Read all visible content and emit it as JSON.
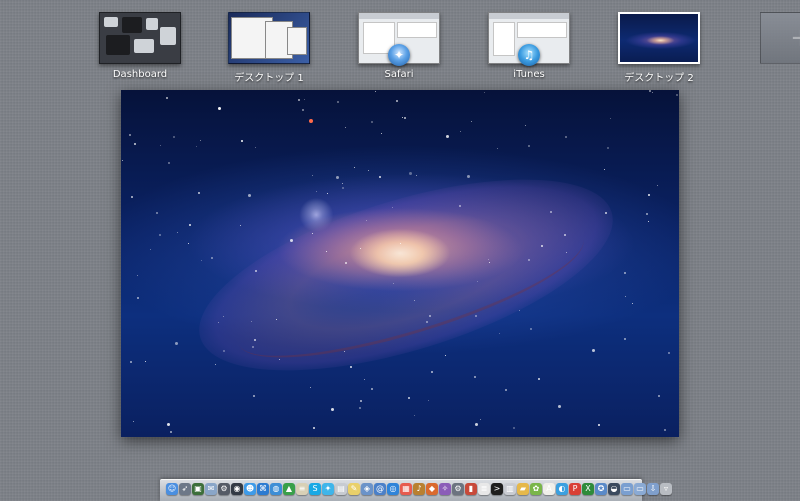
{
  "spaces": [
    {
      "label": "Dashboard",
      "kind": "dashboard",
      "active": false
    },
    {
      "label": "デスクトップ 1",
      "kind": "desktop",
      "active": false
    },
    {
      "label": "Safari",
      "kind": "app",
      "icon": "safari-icon",
      "active": false
    },
    {
      "label": "iTunes",
      "kind": "app",
      "icon": "itunes-icon",
      "active": false
    },
    {
      "label": "デスクトップ 2",
      "kind": "desktop",
      "active": true
    }
  ],
  "add_space": {
    "icon": "plus-icon"
  },
  "desktop_preview": {
    "wallpaper": "andromeda-galaxy"
  },
  "dock": {
    "icons": [
      {
        "name": "finder-icon",
        "color": "#4a8fe0",
        "glyph": "☺"
      },
      {
        "name": "rocket-icon",
        "color": "#6d7888",
        "glyph": "➶"
      },
      {
        "name": "photo-icon",
        "color": "#3d6f3a",
        "glyph": "▣"
      },
      {
        "name": "mail-icon",
        "color": "#8aa6c8",
        "glyph": "✉"
      },
      {
        "name": "system-icon",
        "color": "#555b66",
        "glyph": "⚙"
      },
      {
        "name": "camera-icon",
        "color": "#333a44",
        "glyph": "◉"
      },
      {
        "name": "finder-icon",
        "color": "#3d9be9",
        "glyph": "☻"
      },
      {
        "name": "network-icon",
        "color": "#2c7bd1",
        "glyph": "⌘"
      },
      {
        "name": "globe-icon",
        "color": "#3d8ed6",
        "glyph": "◍"
      },
      {
        "name": "app-icon",
        "color": "#39a04a",
        "glyph": "▲"
      },
      {
        "name": "document-icon",
        "color": "#d8d0b6",
        "glyph": "≡"
      },
      {
        "name": "skype-icon",
        "color": "#19a9e5",
        "glyph": "S"
      },
      {
        "name": "twitter-icon",
        "color": "#3fb5ea",
        "glyph": "✦"
      },
      {
        "name": "app-icon",
        "color": "#c7cbd1",
        "glyph": "▤"
      },
      {
        "name": "notes-icon",
        "color": "#e9d06a",
        "glyph": "✎"
      },
      {
        "name": "photo-icon",
        "color": "#6b93c9",
        "glyph": "◈"
      },
      {
        "name": "mail-icon",
        "color": "#4a80c9",
        "glyph": "@"
      },
      {
        "name": "safari-icon",
        "color": "#2f84d9",
        "glyph": "◎"
      },
      {
        "name": "calendar-icon",
        "color": "#e75b4f",
        "glyph": "▦"
      },
      {
        "name": "music-icon",
        "color": "#b98030",
        "glyph": "♪"
      },
      {
        "name": "app-icon",
        "color": "#da6a2e",
        "glyph": "◆"
      },
      {
        "name": "app-icon",
        "color": "#8b5db8",
        "glyph": "✧"
      },
      {
        "name": "preferences-icon",
        "color": "#6c7480",
        "glyph": "⚙"
      },
      {
        "name": "book-icon",
        "color": "#c84a3a",
        "glyph": "▮"
      },
      {
        "name": "document-icon",
        "color": "#e8e8e8",
        "glyph": "≣"
      },
      {
        "name": "terminal-icon",
        "color": "#1e1e1e",
        "glyph": ">"
      },
      {
        "name": "app-icon",
        "color": "#c9ccd2",
        "glyph": "▥"
      },
      {
        "name": "folder-icon",
        "color": "#e6b84a",
        "glyph": "▰"
      },
      {
        "name": "app-icon",
        "color": "#7ab64a",
        "glyph": "✿"
      },
      {
        "name": "dictionary-icon",
        "color": "#f0efe9",
        "glyph": "A"
      },
      {
        "name": "app-icon",
        "color": "#3aa0e0",
        "glyph": "◐"
      },
      {
        "name": "app-icon",
        "color": "#d94036",
        "glyph": "P"
      },
      {
        "name": "excel-icon",
        "color": "#2e8b3a",
        "glyph": "X"
      },
      {
        "name": "app-icon",
        "color": "#5a8ac8",
        "glyph": "✪"
      },
      {
        "name": "app-icon",
        "color": "#3b4a5e",
        "glyph": "◒"
      },
      {
        "name": "folder-icon",
        "color": "#7a9fd0",
        "glyph": "▭"
      },
      {
        "name": "folder-icon",
        "color": "#8aaad4",
        "glyph": "▭"
      },
      {
        "name": "downloads-icon",
        "color": "#7f9fcc",
        "glyph": "⇩"
      },
      {
        "name": "trash-icon",
        "color": "#b8bcc2",
        "glyph": "▿"
      }
    ]
  }
}
